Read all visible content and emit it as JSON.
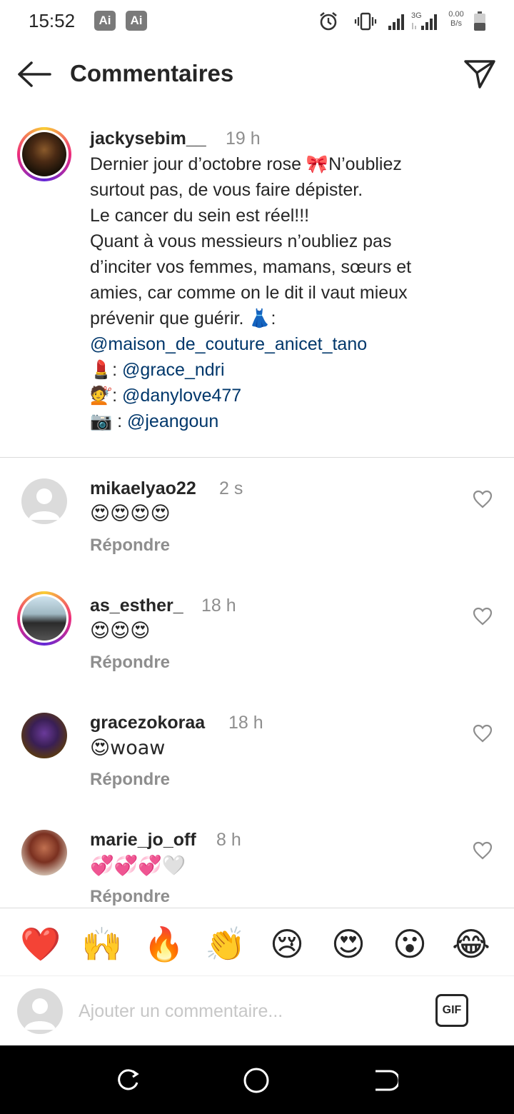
{
  "status_bar": {
    "time": "15:52",
    "badges": [
      "Ai",
      "Ai"
    ],
    "network_type": "3G",
    "net_speed_value": "0.00",
    "net_speed_unit": "B/s",
    "icons": [
      "alarm-icon",
      "vibrate-icon",
      "signal-icon",
      "battery-icon"
    ]
  },
  "header": {
    "title": "Commentaires",
    "back_icon": "arrow-left-icon",
    "share_icon": "send-icon"
  },
  "caption": {
    "username": "jackysebim__",
    "time": "19 h",
    "lines": {
      "l1a": "Dernier jour d’octobre rose ",
      "l1_emoji": "🎀",
      "l1b": "N’oubliez",
      "l2": "surtout pas, de vous faire dépister.",
      "l3": "Le cancer du sein est réel!!!",
      "l4": "Quant à vous messieurs n’oubliez pas",
      "l5": "d’inciter vos femmes, mamans, sœurs et",
      "l6": "amies, car comme on le dit il vaut mieux",
      "l7a": "prévenir que guérir. ",
      "l7_emoji": "👗",
      "l7b": ":",
      "mention1": "@maison_de_couture_anicet_tano",
      "l9_emoji": "💄",
      "l9_sep": ": ",
      "mention2": "@grace_ndri",
      "l10_emoji": "💇",
      "l10_sep": ": ",
      "mention3": "@danylove477",
      "l11_emoji": "📷",
      "l11_sep": " : ",
      "mention4": "@jeangoun"
    }
  },
  "comments": [
    {
      "username": "mikaelyao22",
      "time": "2 s",
      "text": "😍😍😍😍",
      "reply": "Répondre"
    },
    {
      "username": "as_esther_",
      "time": "18 h",
      "text": "😍😍😍",
      "reply": "Répondre"
    },
    {
      "username": "gracezokoraa",
      "time": "18 h",
      "text": "😍woaw",
      "reply": "Répondre"
    },
    {
      "username": "marie_jo_off",
      "time": "8 h",
      "text": "💞💞💞🤍",
      "reply": "Répondre"
    }
  ],
  "reactions": [
    "❤️",
    "🙌",
    "🔥",
    "👏",
    "😢",
    "😍",
    "😮",
    "😂"
  ],
  "input": {
    "placeholder": "Ajouter un commentaire...",
    "gif_label": "GIF"
  },
  "colors": {
    "text": "#262626",
    "secondary": "#8e8e8e",
    "mention": "#00376b",
    "divider": "#dbdbdb",
    "nav_bar": "#000000"
  }
}
